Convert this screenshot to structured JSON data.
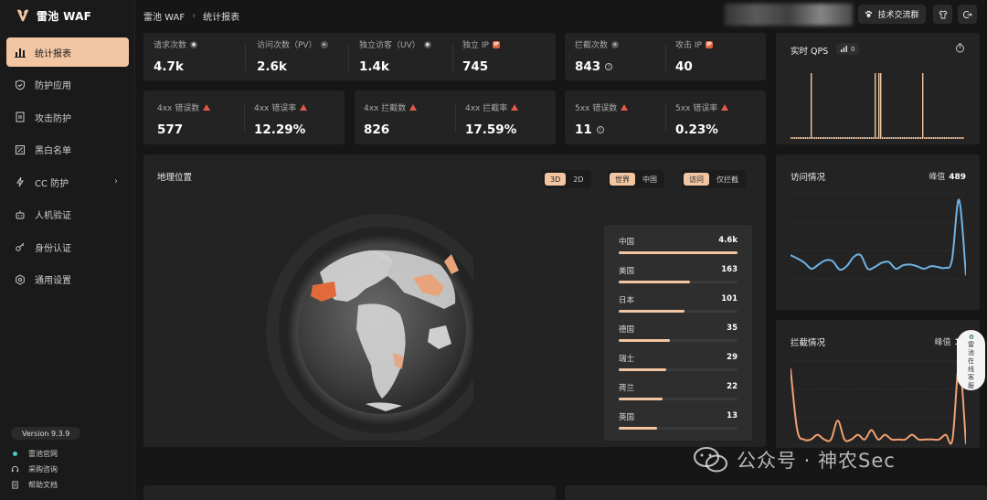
{
  "app": {
    "name": "雷池 WAF"
  },
  "breadcrumb": {
    "root": "雷池 WAF",
    "current": "统计报表"
  },
  "header": {
    "community_button": "技术交流群"
  },
  "sidebar": {
    "items": [
      {
        "label": "统计报表",
        "icon": "bar-chart-icon",
        "active": true
      },
      {
        "label": "防护应用",
        "icon": "shield-icon"
      },
      {
        "label": "攻击防护",
        "icon": "document-icon"
      },
      {
        "label": "黑白名单",
        "icon": "list-icon"
      },
      {
        "label": "CC 防护",
        "icon": "lightning-icon",
        "has_submenu": true
      },
      {
        "label": "人机验证",
        "icon": "robot-icon"
      },
      {
        "label": "身份认证",
        "icon": "key-icon"
      },
      {
        "label": "通用设置",
        "icon": "gear-icon"
      }
    ],
    "version": "Version 9.3.9",
    "links": [
      {
        "label": "雷池官网",
        "icon": "dot-icon"
      },
      {
        "label": "采购咨询",
        "icon": "headset-icon"
      },
      {
        "label": "帮助文档",
        "icon": "doc-icon"
      }
    ]
  },
  "stats_row1": [
    {
      "label": "请求次数",
      "value": "4.7k",
      "badge": "user-icon"
    },
    {
      "label": "访问次数（PV）",
      "value": "2.6k",
      "badge": "send-icon"
    },
    {
      "label": "独立访客（UV）",
      "value": "1.4k",
      "badge": "users-icon"
    },
    {
      "label": "独立 IP",
      "value": "745",
      "badge": "IP"
    },
    {
      "label": "拦截次数",
      "value": "843",
      "badge": "block-icon"
    },
    {
      "label": "攻击 IP",
      "value": "40",
      "badge": "IP"
    }
  ],
  "stats_row2": [
    {
      "label": "4xx 错误数",
      "value": "577"
    },
    {
      "label": "4xx 错误率",
      "value": "12.29%"
    },
    {
      "label": "4xx 拦截数",
      "value": "826"
    },
    {
      "label": "4xx 拦截率",
      "value": "17.59%"
    },
    {
      "label": "5xx 错误数",
      "value": "11"
    },
    {
      "label": "5xx 错误率",
      "value": "0.23%"
    }
  ],
  "geo": {
    "title": "地理位置",
    "view_modes": [
      "3D",
      "2D"
    ],
    "scopes": [
      "世界",
      "中国"
    ],
    "types": [
      "访问",
      "仅拦截"
    ],
    "countries": [
      {
        "name": "中国",
        "count": "4.6k",
        "ratio": 1.0
      },
      {
        "name": "美国",
        "count": "163",
        "ratio": 0.6
      },
      {
        "name": "日本",
        "count": "101",
        "ratio": 0.55
      },
      {
        "name": "德国",
        "count": "35",
        "ratio": 0.43
      },
      {
        "name": "瑞士",
        "count": "29",
        "ratio": 0.4
      },
      {
        "name": "荷兰",
        "count": "22",
        "ratio": 0.37
      },
      {
        "name": "英国",
        "count": "13",
        "ratio": 0.32
      }
    ]
  },
  "qps": {
    "title": "实时 QPS",
    "value": "0"
  },
  "visits": {
    "title": "访问情况",
    "peak_label": "峰值",
    "peak_value": "489"
  },
  "blocks": {
    "title": "拦截情况",
    "peak_label": "峰值",
    "peak_value": "17"
  },
  "chat_widget": {
    "text": "雷池在线客服"
  },
  "watermark": "公众号 · 神农Sec",
  "colors": {
    "accent": "#f2c6a3",
    "line_blue": "#6fb3e6",
    "line_orange": "#f0a070",
    "danger": "#e05a4a"
  },
  "chart_data": [
    {
      "type": "bar",
      "title": "实时 QPS",
      "values": [
        0,
        0,
        0,
        0,
        0,
        0,
        0,
        0,
        0,
        0,
        0,
        1,
        0,
        0,
        0,
        0,
        0,
        0,
        0,
        0,
        0,
        0,
        0,
        0,
        0,
        0,
        0,
        0,
        0,
        0,
        0,
        0,
        0,
        0,
        0,
        0,
        0,
        0,
        0,
        0,
        0,
        0,
        0,
        0,
        0,
        0,
        1,
        0,
        1,
        1,
        0,
        0,
        0,
        0,
        0,
        0,
        0,
        0,
        0,
        0,
        0,
        0,
        0,
        0,
        0,
        0,
        0,
        0,
        0,
        0,
        0,
        0,
        1,
        0,
        0,
        0,
        0,
        0,
        0,
        0,
        0,
        0,
        0,
        0,
        0,
        0,
        0,
        0,
        0,
        0,
        0,
        0,
        0,
        0,
        0
      ]
    },
    {
      "type": "line",
      "title": "访问情况",
      "values": [
        140,
        120,
        95,
        60,
        85,
        110,
        105,
        55,
        75,
        130,
        140,
        60,
        70,
        95,
        100,
        60,
        80,
        85,
        75,
        60,
        75,
        70,
        65,
        110,
        470,
        20
      ],
      "ylim": [
        0,
        489
      ]
    },
    {
      "type": "line",
      "title": "拦截情况",
      "values": [
        16,
        3,
        1,
        1,
        2,
        1,
        1,
        5,
        1,
        1,
        2,
        1,
        3,
        1,
        2,
        1,
        1,
        1,
        2,
        1,
        1,
        1,
        1,
        2,
        1,
        17,
        0
      ],
      "ylim": [
        0,
        17
      ]
    }
  ]
}
